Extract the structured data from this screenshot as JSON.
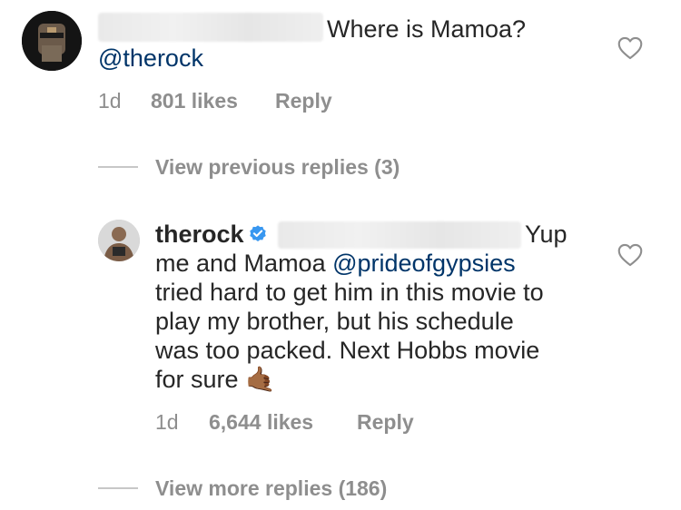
{
  "comment": {
    "text": "Where is Mamoa?",
    "mention": "@therock",
    "time": "1d",
    "likes": "801 likes",
    "reply_label": "Reply",
    "view_previous": "View previous replies (3)"
  },
  "reply": {
    "username": "therock",
    "line1_tail": "Yup",
    "line2_text": "me and Mamoa ",
    "line2_mention": "@prideofgypsies",
    "line3": "tried hard to get him in this movie to",
    "line4": "play my brother, but his schedule",
    "line5": "was too packed. Next Hobbs movie",
    "line6": "for sure",
    "emoji": "🤙🏾",
    "time": "1d",
    "likes": "6,644 likes",
    "reply_label": "Reply",
    "view_more": "View more replies (186)"
  },
  "colors": {
    "text": "#262626",
    "mention": "#003569",
    "meta": "#8e8e8e",
    "verified": "#3897f0"
  },
  "icons": [
    "heart-icon",
    "verified-badge-icon"
  ]
}
